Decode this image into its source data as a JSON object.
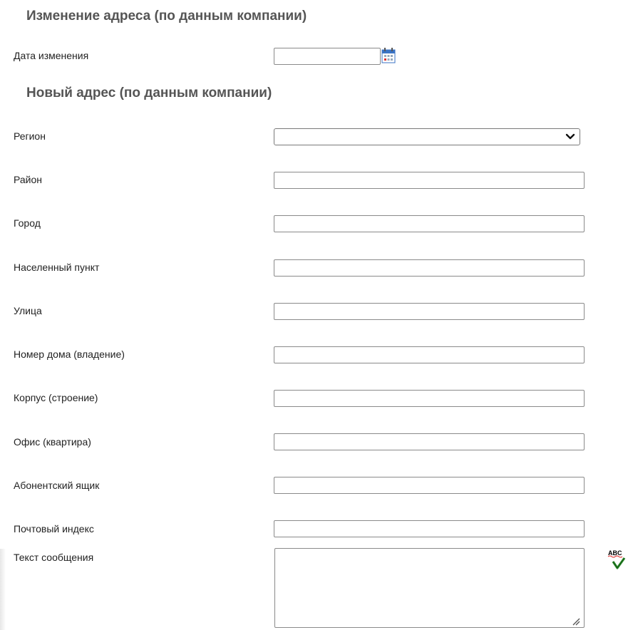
{
  "sections": {
    "change_title": "Изменение адреса (по данным компании)",
    "new_address_title": "Новый адрес (по данным компании)"
  },
  "change_date": {
    "label": "Дата изменения",
    "value": "",
    "icon": "calendar-icon"
  },
  "fields": {
    "region": {
      "label": "Регион",
      "value": ""
    },
    "district": {
      "label": "Район",
      "value": ""
    },
    "city": {
      "label": "Город",
      "value": ""
    },
    "locality": {
      "label": "Населенный пункт",
      "value": ""
    },
    "street": {
      "label": "Улица",
      "value": ""
    },
    "house": {
      "label": "Номер дома (владение)",
      "value": ""
    },
    "building": {
      "label": "Корпус (строение)",
      "value": ""
    },
    "office": {
      "label": "Офис (квартира)",
      "value": ""
    },
    "po_box": {
      "label": "Абонентский ящик",
      "value": ""
    },
    "postal_code": {
      "label": "Почтовый индекс",
      "value": ""
    },
    "message": {
      "label": "Текст сообщения",
      "value": ""
    }
  },
  "icons": {
    "spellcheck": "spellcheck-icon",
    "dropdown": "chevron-down-icon",
    "resize": "resize-grip-icon"
  },
  "colors": {
    "title": "#555555",
    "border": "#8a8a8a",
    "calendar_blue": "#3b73c4",
    "spell_green": "#2e8b2e"
  }
}
